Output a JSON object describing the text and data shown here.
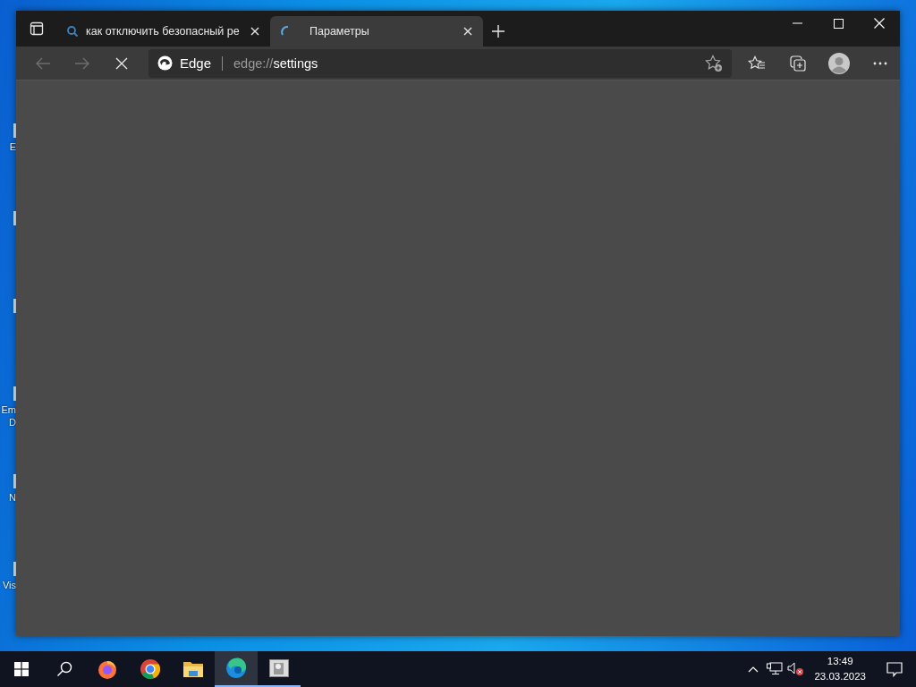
{
  "desktop_icons": [
    {
      "kind": "shortcut",
      "lines": [
        "E"
      ]
    },
    {
      "kind": "shortcut"
    },
    {
      "kind": "shortcut"
    },
    {
      "kind": "shortcut",
      "lines": [
        "Em",
        "D"
      ]
    },
    {
      "kind": "shortcut",
      "lines": [
        "N"
      ]
    },
    {
      "kind": "shortcut",
      "lines": [
        "Vis"
      ]
    }
  ],
  "browser": {
    "tabs": [
      {
        "kind": "search",
        "title": "как отключить безопасный ре",
        "selected": false
      },
      {
        "kind": "loading",
        "title": "Параметры",
        "selected": true
      }
    ],
    "address": {
      "site_label": "Edge",
      "url_prefix": "edge://",
      "url_path": "settings"
    }
  },
  "taskbar": {
    "apps": [
      {
        "kind": "firefox",
        "selected": false,
        "running": false
      },
      {
        "kind": "chrome",
        "selected": false,
        "running": false
      },
      {
        "kind": "explorer",
        "selected": false,
        "running": false
      },
      {
        "kind": "edge",
        "selected": true,
        "running": true
      },
      {
        "kind": "window",
        "selected": false,
        "running": true
      }
    ],
    "time": "13:49",
    "date": "23.03.2023"
  }
}
